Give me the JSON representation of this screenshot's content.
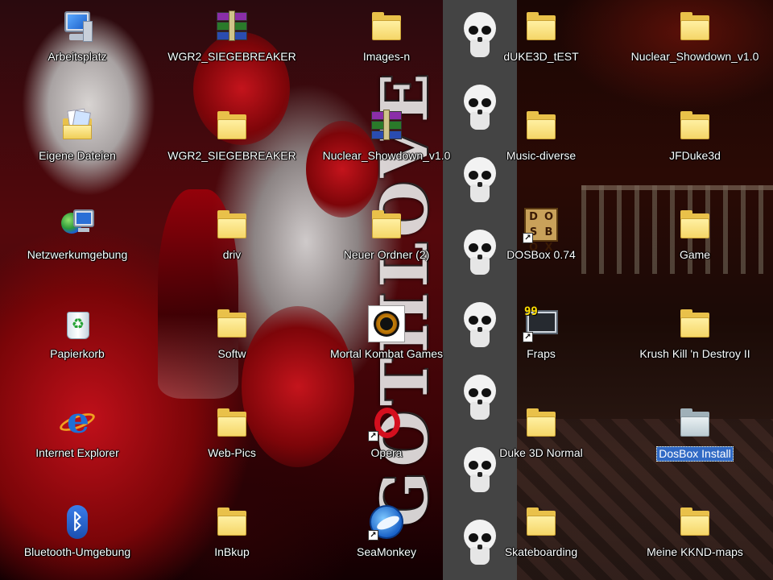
{
  "wallpaper": {
    "text": "GOTHLOVE"
  },
  "icons": {
    "arbeitsplatz": "Arbeitsplatz",
    "eigene_dateien": "Eigene Dateien",
    "netzwerkumgebung": "Netzwerkumgebung",
    "papierkorb": "Papierkorb",
    "internet_explorer": "Internet Explorer",
    "bluetooth": "Bluetooth-Umgebung",
    "wgr2_archive": "WGR2_SIEGEBREAKER",
    "wgr2_folder": "WGR2_SIEGEBREAKER",
    "driv": "driv",
    "softw": "Softw",
    "web_pics": "Web-Pics",
    "inbkup": "InBkup",
    "images_n": "Images-n",
    "nuclear_archive": "Nuclear_Showdown_v1.0",
    "neuer_ordner": "Neuer Ordner (2)",
    "mortal_kombat": "Mortal Kombat Games",
    "opera": "Opera",
    "seamonkey": "SeaMonkey",
    "duke3d_test": "dUKE3D_tEST",
    "music_diverse": "Music-diverse",
    "dosbox": "DOSBox 0.74",
    "fraps": "Fraps",
    "duke3d_normal": "Duke 3D Normal",
    "skateboarding": "Skateboarding",
    "nuclear_folder": "Nuclear_Showdown_v1.0",
    "jfduke3d": "JFDuke3d",
    "game": "Game",
    "krush_kill": "Krush Kill 'n Destroy II",
    "dosbox_install": "DosBox Install",
    "kknd_maps": "Meine KKND-maps"
  },
  "icon_glyphs": {
    "dosbox_letters": [
      "D",
      "O",
      "S",
      "B",
      "O",
      "X"
    ],
    "fraps_number": "99",
    "shortcut_arrow": "↗",
    "recycle_symbol": "♻",
    "bluetooth_symbol": "ᛒ",
    "ie_letter": "e"
  },
  "selected_icon": "dosbox_install"
}
